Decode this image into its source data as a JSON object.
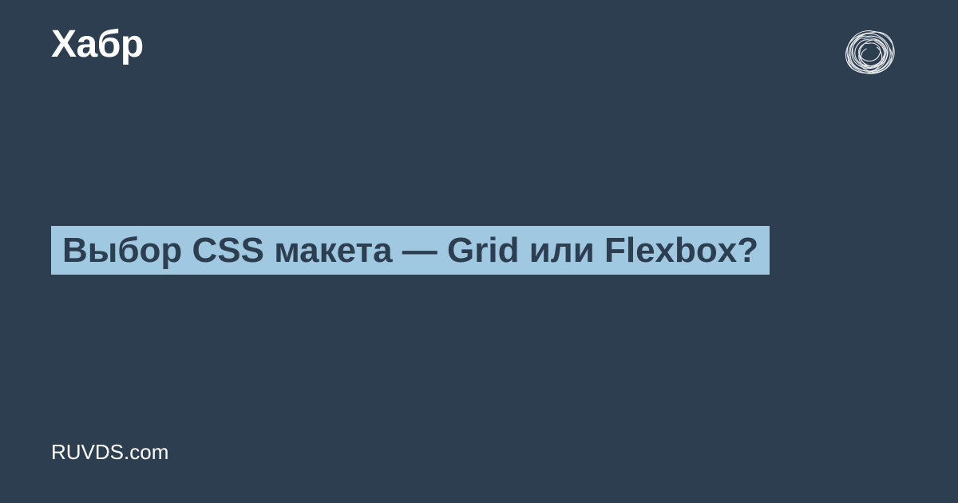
{
  "header": {
    "site_name": "Хабр"
  },
  "content": {
    "title": "Выбор CSS макета — Grid или Flexbox?"
  },
  "footer": {
    "author": "RUVDS.com"
  }
}
